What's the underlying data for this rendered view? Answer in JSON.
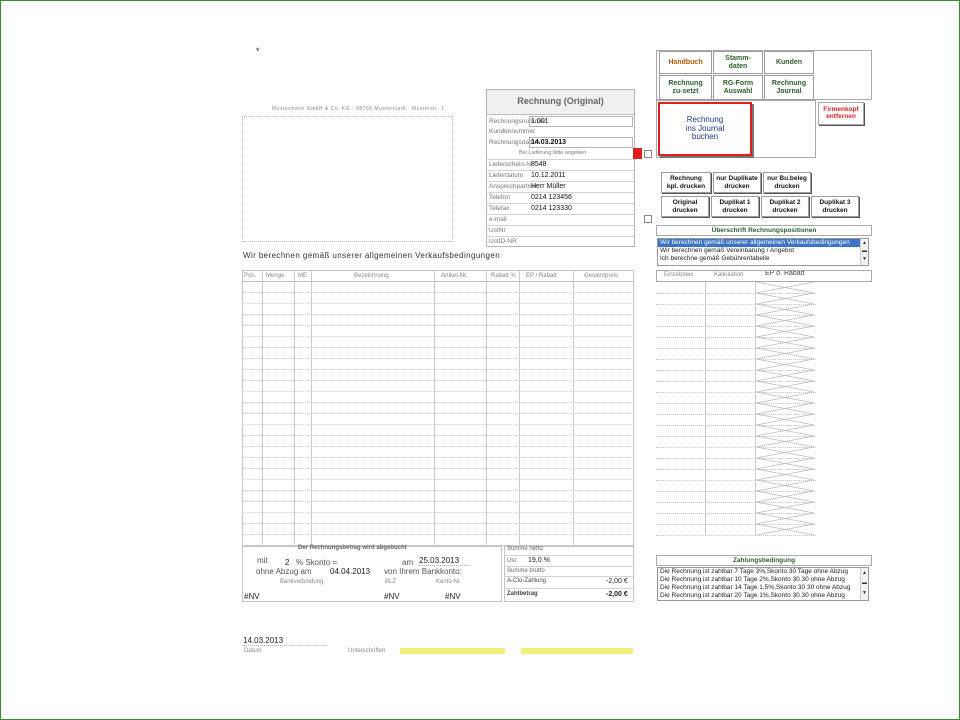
{
  "asterisk": "*",
  "sender_line": "Mustermann GmbH & Co. KG · 98765 Musterstadt · Musterstr. 1",
  "intro_text": "Wir berechnen gemäß unserer allgemeinen Verkaufsbedingungen",
  "invoice": {
    "title": "Rechnung   (Original)",
    "rows": [
      {
        "label": "Rechnungsnummer",
        "value": "1.001"
      },
      {
        "label": "Kundennummer",
        "value": ""
      },
      {
        "label": "Rechnungsdatum",
        "value": "14.03.2013"
      }
    ],
    "delivery_note": "Bei Lieferung bitte angeben",
    "rows2": [
      {
        "label": "Lieferschein-Nr",
        "value": "8548"
      },
      {
        "label": "Lieferdatum",
        "value": "10.12.2011"
      },
      {
        "label": "Ansprechpartner",
        "value": "Herr Müller"
      },
      {
        "label": "Telefon",
        "value": "0214 123456"
      },
      {
        "label": "Telefax",
        "value": "0214 123330"
      },
      {
        "label": "e-mail",
        "value": ""
      },
      {
        "label": "UstNr",
        "value": ""
      },
      {
        "label": "UstID-NR",
        "value": ""
      }
    ]
  },
  "table": {
    "headers": [
      "Pos.",
      "Menge",
      "ME",
      "Bezeichnung",
      "Artikel-Nr.",
      "Rabatt %",
      "EP / Rabatt",
      "Gesamtpreis"
    ]
  },
  "bottom": {
    "notice": "Der Rechnungsbetrag wird abgebucht",
    "mit": "mit",
    "skonto_pct": "2",
    "skonto_label": "% Skonto =",
    "am": "am",
    "skonto_date": "25.03.2013",
    "ohne_label": "ohne Abzug am",
    "ohne_date": "04.04.2013",
    "bank_text": "von Ihrem Bankkonto:",
    "col_bank": "Bankverbindung",
    "col_blz": "BLZ",
    "col_konto": "Konto-Nr.",
    "nv1": "#NV",
    "nv2": "#NV",
    "nv3": "#NV"
  },
  "totals": {
    "netto_label": "Summe netto",
    "ust_label": "Ust",
    "ust_value": "19,0 %",
    "brutto_label": "Summe brutto",
    "acto_label": "A-Cto-Zahlung",
    "acto_value": "-2,00 €",
    "zahl_label": "Zahlbetrag",
    "zahl_value": "-2,00 €"
  },
  "footer": {
    "date": "14.03.2013",
    "datum_label": "Datum",
    "unterschriften_label": "Unterschriften"
  },
  "right_panel": {
    "top_buttons": [
      "Handbuch",
      "Stamm-\ndaten",
      "Kunden",
      "Rechnung\nzu-setzt",
      "RG-Form\nAuswahl",
      "Rechnung\nJournal"
    ],
    "journal_button": "Rechnung\nins Journal\nbuchen",
    "firmenkopf_button": "Firmenkopf\nentfernen",
    "print_buttons": [
      "Rechnung\nkpl. drucken",
      "nur Duplikate\ndrucken",
      "nur Bu.beleg\ndrucken",
      "Original\ndrucken",
      "Duplikat 1\ndrucken",
      "Duplikat 2\ndrucken",
      "Duplikat 3\ndrucken"
    ],
    "headline_title": "Überschrift Rechnungspositionen",
    "headline_options": [
      "Wir berechnen gemäß unserer allgemeinen Verkaufsbedingungen",
      "Wir berechnen gemäß Vereinbarung / Angebot",
      "Ich berechne gemäß Gebührentabelle"
    ],
    "col_headers": [
      "Einzelpreis",
      "Kalkulation",
      "EP o. Rabatt"
    ],
    "payment_title": "Zahlungsbedingung",
    "payment_options": [
      "Die Rechnung ist zahlbar 7 Tage  3%,Skonto 30 Tage ohne Abzug",
      "Die Rechnung ist zahlbar 10 Tage  2%,Skonto 30 30 ohne Abzug",
      "Die Rechnung ist zahlbar 14 Tage  1,5%,Skonto 30 30 ohne Abzug",
      "Die Rechnung ist zahlbar 20 Tage  1%,Skonto 30 30 ohne Abzug"
    ]
  },
  "colors": {
    "accent_red": "#e11d1d",
    "button_green": "#2c5f2c",
    "frame_green": "#3a8a3a",
    "selection_blue": "#3a74c8",
    "signature_yellow": "#f3f07a"
  }
}
